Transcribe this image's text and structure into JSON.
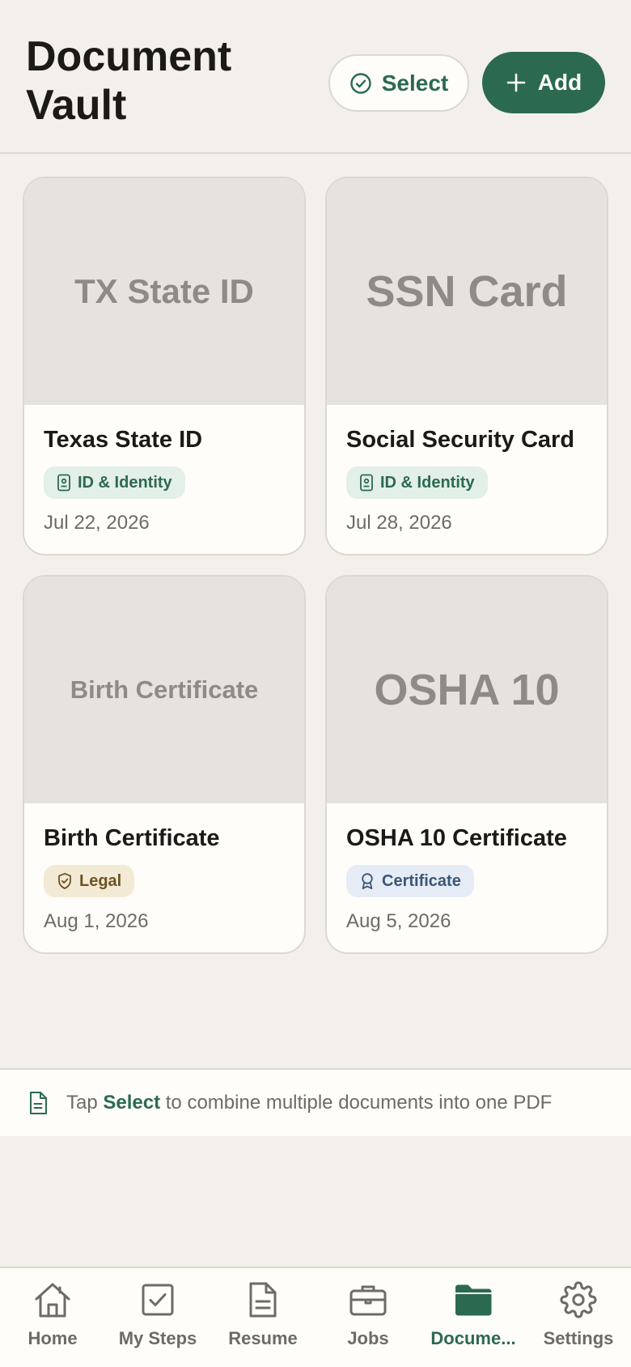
{
  "header": {
    "title": "Document Vault",
    "select_label": "Select",
    "add_label": "Add"
  },
  "documents": [
    {
      "thumb_text": "TX State ID",
      "title": "Texas State ID",
      "tag": "ID & Identity",
      "tag_icon": "id-card-icon",
      "date": "Jul 22, 2026"
    },
    {
      "thumb_text": "SSN Card",
      "title": "Social Security Card",
      "tag": "ID & Identity",
      "tag_icon": "id-card-icon",
      "date": "Jul 28, 2026"
    },
    {
      "thumb_text": "Birth Certificate",
      "title": "Birth Certificate",
      "tag": "Legal",
      "tag_icon": "shield-icon",
      "date": "Aug 1, 2026"
    },
    {
      "thumb_text": "OSHA 10",
      "title": "OSHA 10 Certificate",
      "tag": "Certificate",
      "tag_icon": "award-icon",
      "date": "Aug 5, 2026"
    }
  ],
  "hint": {
    "prefix": "Tap",
    "emphasis": "Select",
    "suffix": "to combine multiple documents into one PDF"
  },
  "tabbar": {
    "items": [
      {
        "label": "Home",
        "icon": "home-icon"
      },
      {
        "label": "My Steps",
        "icon": "checkbox-icon"
      },
      {
        "label": "Resume",
        "icon": "document-icon"
      },
      {
        "label": "Jobs",
        "icon": "briefcase-icon"
      },
      {
        "label": "Docume...",
        "icon": "folder-icon",
        "active": true
      },
      {
        "label": "Settings",
        "icon": "gear-icon"
      }
    ]
  },
  "colors": {
    "accent": "#2c6a4f",
    "background": "#f3f0eb",
    "card": "#fffdf9"
  }
}
